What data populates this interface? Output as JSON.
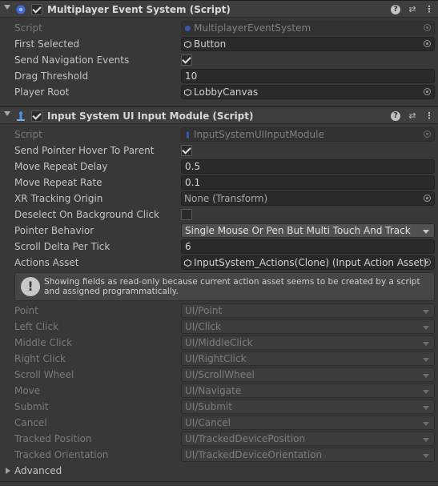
{
  "components": [
    {
      "title": "Multiplayer Event System (Script)",
      "icon": "event-system-icon",
      "enabled": true,
      "fields": [
        {
          "label": "Script",
          "value": "MultiplayerEventSystem",
          "disabled": true
        },
        {
          "label": "First Selected",
          "value": "Button"
        },
        {
          "label": "Send Navigation Events",
          "checked": true
        },
        {
          "label": "Drag Threshold",
          "value": "10"
        },
        {
          "label": "Player Root",
          "value": "LobbyCanvas"
        }
      ]
    },
    {
      "title": "Input System UI Input Module (Script)",
      "icon": "input-module-icon",
      "enabled": true,
      "fields": [
        {
          "label": "Script",
          "value": "InputSystemUIInputModule",
          "disabled": true
        },
        {
          "label": "Send Pointer Hover To Parent",
          "checked": true
        },
        {
          "label": "Move Repeat Delay",
          "value": "0.5"
        },
        {
          "label": "Move Repeat Rate",
          "value": "0.1"
        },
        {
          "label": "XR Tracking Origin",
          "value": "None (Transform)"
        },
        {
          "label": "Deselect On Background Click",
          "checked": false
        },
        {
          "label": "Pointer Behavior",
          "value": "Single Mouse Or Pen But Multi Touch And Track"
        },
        {
          "label": "Scroll Delta Per Tick",
          "value": "6"
        },
        {
          "label": "Actions Asset",
          "value": "InputSystem_Actions(Clone) (Input Action Asset)"
        }
      ],
      "helpbox": "Showing fields as read-only because current action asset seems to be created by a script and assigned programmatically.",
      "actions": [
        {
          "label": "Point",
          "value": "UI/Point"
        },
        {
          "label": "Left Click",
          "value": "UI/Click"
        },
        {
          "label": "Middle Click",
          "value": "UI/MiddleClick"
        },
        {
          "label": "Right Click",
          "value": "UI/RightClick"
        },
        {
          "label": "Scroll Wheel",
          "value": "UI/ScrollWheel"
        },
        {
          "label": "Move",
          "value": "UI/Navigate"
        },
        {
          "label": "Submit",
          "value": "UI/Submit"
        },
        {
          "label": "Cancel",
          "value": "UI/Cancel"
        },
        {
          "label": "Tracked Position",
          "value": "UI/TrackedDevicePosition"
        },
        {
          "label": "Tracked Orientation",
          "value": "UI/TrackedDeviceOrientation"
        }
      ],
      "advanced_label": "Advanced"
    }
  ],
  "header_buttons": {
    "help": "?",
    "presets": "⇄",
    "menu": "⋮"
  },
  "colors": {
    "background": "#383838",
    "field": "#2a2a2a",
    "header": "#3e3e3e",
    "dropdown": "#515151"
  }
}
